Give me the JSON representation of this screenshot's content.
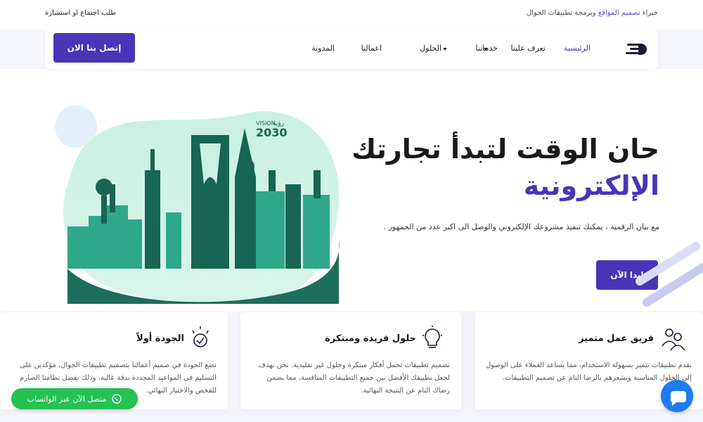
{
  "topbar": {
    "tagline_pre": "خبراء ",
    "tagline_hl": "تصميم المواقع",
    "tagline_post": " وبرمجة تطبيقات الجوال",
    "request_link": "طلب اجتماع او استشارة"
  },
  "nav": {
    "contact_button": "إتصل بنا الان",
    "items": [
      {
        "label": "الرئيسية",
        "active": true
      },
      {
        "label": "تعرف علينا"
      },
      {
        "label": "خدماتنا"
      },
      {
        "label": "الحلول"
      },
      {
        "label": "اعمالنا"
      },
      {
        "label": "المدونة"
      }
    ],
    "logo_icon": "speed-lines-logo"
  },
  "hero": {
    "title_line1": "حان الوقت لتبدأ تجارتك",
    "title_line2": "الإلكترونية",
    "description": "مع بيان الرقمية ، يمكنك تنفيذ مشروعك الإلكتروني والوصل الى اكبر عدد من الجمهور .",
    "start_button": "إبدا الآن",
    "vision_title": "VISION",
    "vision_year": "2030",
    "vision_arabic": "رؤية"
  },
  "cards": [
    {
      "title": "فريق عمل متميز",
      "icon": "team-icon",
      "text": "نقدم تطبيقات تتميز بسهولة الاستخدام، مما يساعد العملاء على الوصول إلى الحلول المناسبة ويشعرهم بالرضا التام عن تصميم التطبيقات."
    },
    {
      "title": "حلول فريدة ومبتكرة",
      "icon": "lightbulb-icon",
      "text": "تصميم تطبيقات تحمل أفكار مبتكرة وحلول غير تقليدية. نحن نهدف لجعل تطبيقك الأفضل بين جميع التطبيقات المنافسة، مما يضمن رضاك التام عن النتيجة النهائية."
    },
    {
      "title": "الجودة أولاً",
      "icon": "quality-badge-icon",
      "text": "نضع الجودة في صميم أعمالنا بتصميم تطبيقات الجوال، مؤكدين على التسليم في المواعيد المحددة بدقة عالية، وذلك بفضل نظامنا الصارم للفحص والاختبار النهائي."
    }
  ],
  "whatsapp": {
    "label": "متصل الآن عبر الواتساب",
    "icon": "whatsapp-icon"
  },
  "chat": {
    "icon": "chat-bubble-icon"
  },
  "colors": {
    "primary": "#4a34b8",
    "teal": "#2fa88a",
    "whatsapp": "#25c153",
    "chat": "#1f7cf0"
  }
}
